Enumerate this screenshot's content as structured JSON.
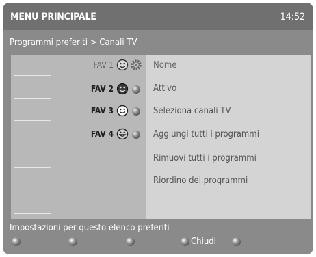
{
  "header": {
    "title": "MENU PRINCIPALE",
    "time": "14:52"
  },
  "breadcrumb": "Programmi preferiti > Canali TV",
  "favorites": [
    {
      "label": "FAV 1",
      "icon": "happy-face-icon"
    },
    {
      "label": "FAV 2",
      "icon": "dark-face-icon"
    },
    {
      "label": "FAV 3",
      "icon": "smile-face-icon"
    },
    {
      "label": "FAV 4",
      "icon": "grin-face-icon"
    }
  ],
  "menu": {
    "items": [
      {
        "label": "Nome"
      },
      {
        "label": "Attivo"
      },
      {
        "label": "Seleziona canali TV"
      },
      {
        "label": "Aggiungi tutti i programmi"
      },
      {
        "label": "Rimuovi tutti i programmi"
      },
      {
        "label": "Riordino dei programmi"
      }
    ]
  },
  "footer": {
    "hint": "Impostazioni per questo elenco preferiti",
    "close_label": "Chiudi"
  },
  "colors": {
    "screen_bg": "#8a8a8a",
    "titlebar_bg": "#707070",
    "left_panel": "#b8b8b8",
    "right_panel": "#d4d4d4"
  }
}
